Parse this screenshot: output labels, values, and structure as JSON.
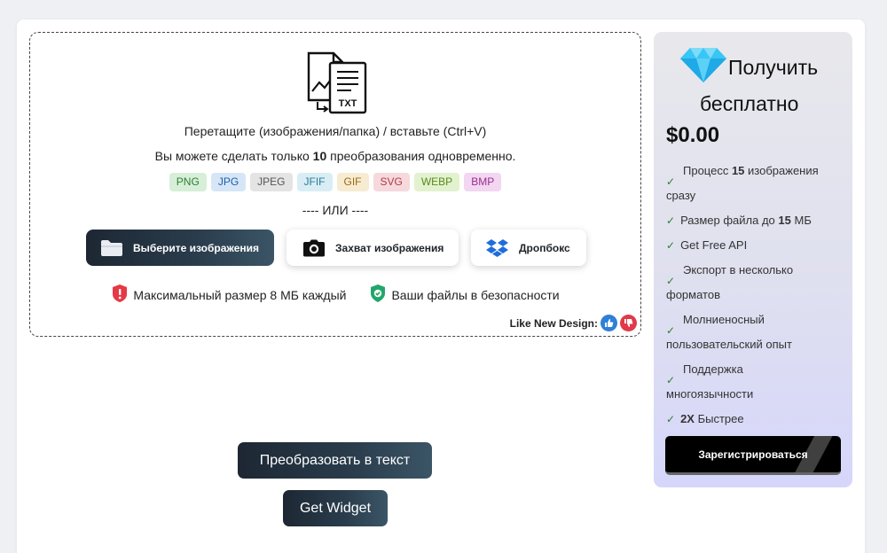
{
  "dropzone": {
    "icon": "image-to-txt-icon",
    "title": "Перетащите (изображения/папка) / вставьте (Ctrl+V)",
    "limit_prefix": "Вы можете сделать только ",
    "limit_count": "10",
    "limit_suffix": " преобразования одновременно.",
    "formats": [
      {
        "label": "PNG",
        "bg": "#d7efd8",
        "color": "#2e7d32"
      },
      {
        "label": "JPG",
        "bg": "#d6e6f7",
        "color": "#1f5fa8"
      },
      {
        "label": "JPEG",
        "bg": "#e4e4e4",
        "color": "#555555"
      },
      {
        "label": "JFIF",
        "bg": "#d9edf5",
        "color": "#2b7a99"
      },
      {
        "label": "GIF",
        "bg": "#f7ecd2",
        "color": "#9a6b12"
      },
      {
        "label": "SVG",
        "bg": "#f6d9dc",
        "color": "#b23a48"
      },
      {
        "label": "WEBP",
        "bg": "#e2f2cf",
        "color": "#5a8a1d"
      },
      {
        "label": "BMP",
        "bg": "#f3d6f1",
        "color": "#9a2f8f"
      }
    ],
    "or_text": "---- ИЛИ ----",
    "buttons": {
      "select": "Выберите изображения",
      "capture": "Захват изображения",
      "dropbox": "Дропбокс"
    },
    "max_size": "Максимальный размер 8 МБ каждый",
    "secure": "Ваши файлы в безопасности",
    "like_text": "Like New Design:"
  },
  "actions": {
    "convert": "Преобразовать в текст",
    "widget": "Get Widget"
  },
  "premium": {
    "title_line1": "Получить",
    "title_line2": "бесплатно",
    "price": "$0.00",
    "features": [
      {
        "pre": "Процесс ",
        "bold": "15",
        "post": " изображения",
        "cont": "сразу"
      },
      {
        "pre": "Размер файла до ",
        "bold": "15",
        "post": " МБ"
      },
      {
        "pre": "Get Free API",
        "bold": "",
        "post": ""
      },
      {
        "pre": "Экспорт в несколько",
        "bold": "",
        "post": "",
        "cont": "форматов"
      },
      {
        "pre": "Молниеносный",
        "bold": "",
        "post": "",
        "cont": "пользовательский опыт"
      },
      {
        "pre": "Поддержка",
        "bold": "",
        "post": "",
        "cont": "многоязычности"
      },
      {
        "pre": "",
        "bold": "2X",
        "post": " Быстрее"
      }
    ],
    "signup": "Зарегистрироваться"
  },
  "colors": {
    "dark_btn": "#1d2733",
    "check": "#2e7d32",
    "premium_bg": "#dfe0ef"
  }
}
